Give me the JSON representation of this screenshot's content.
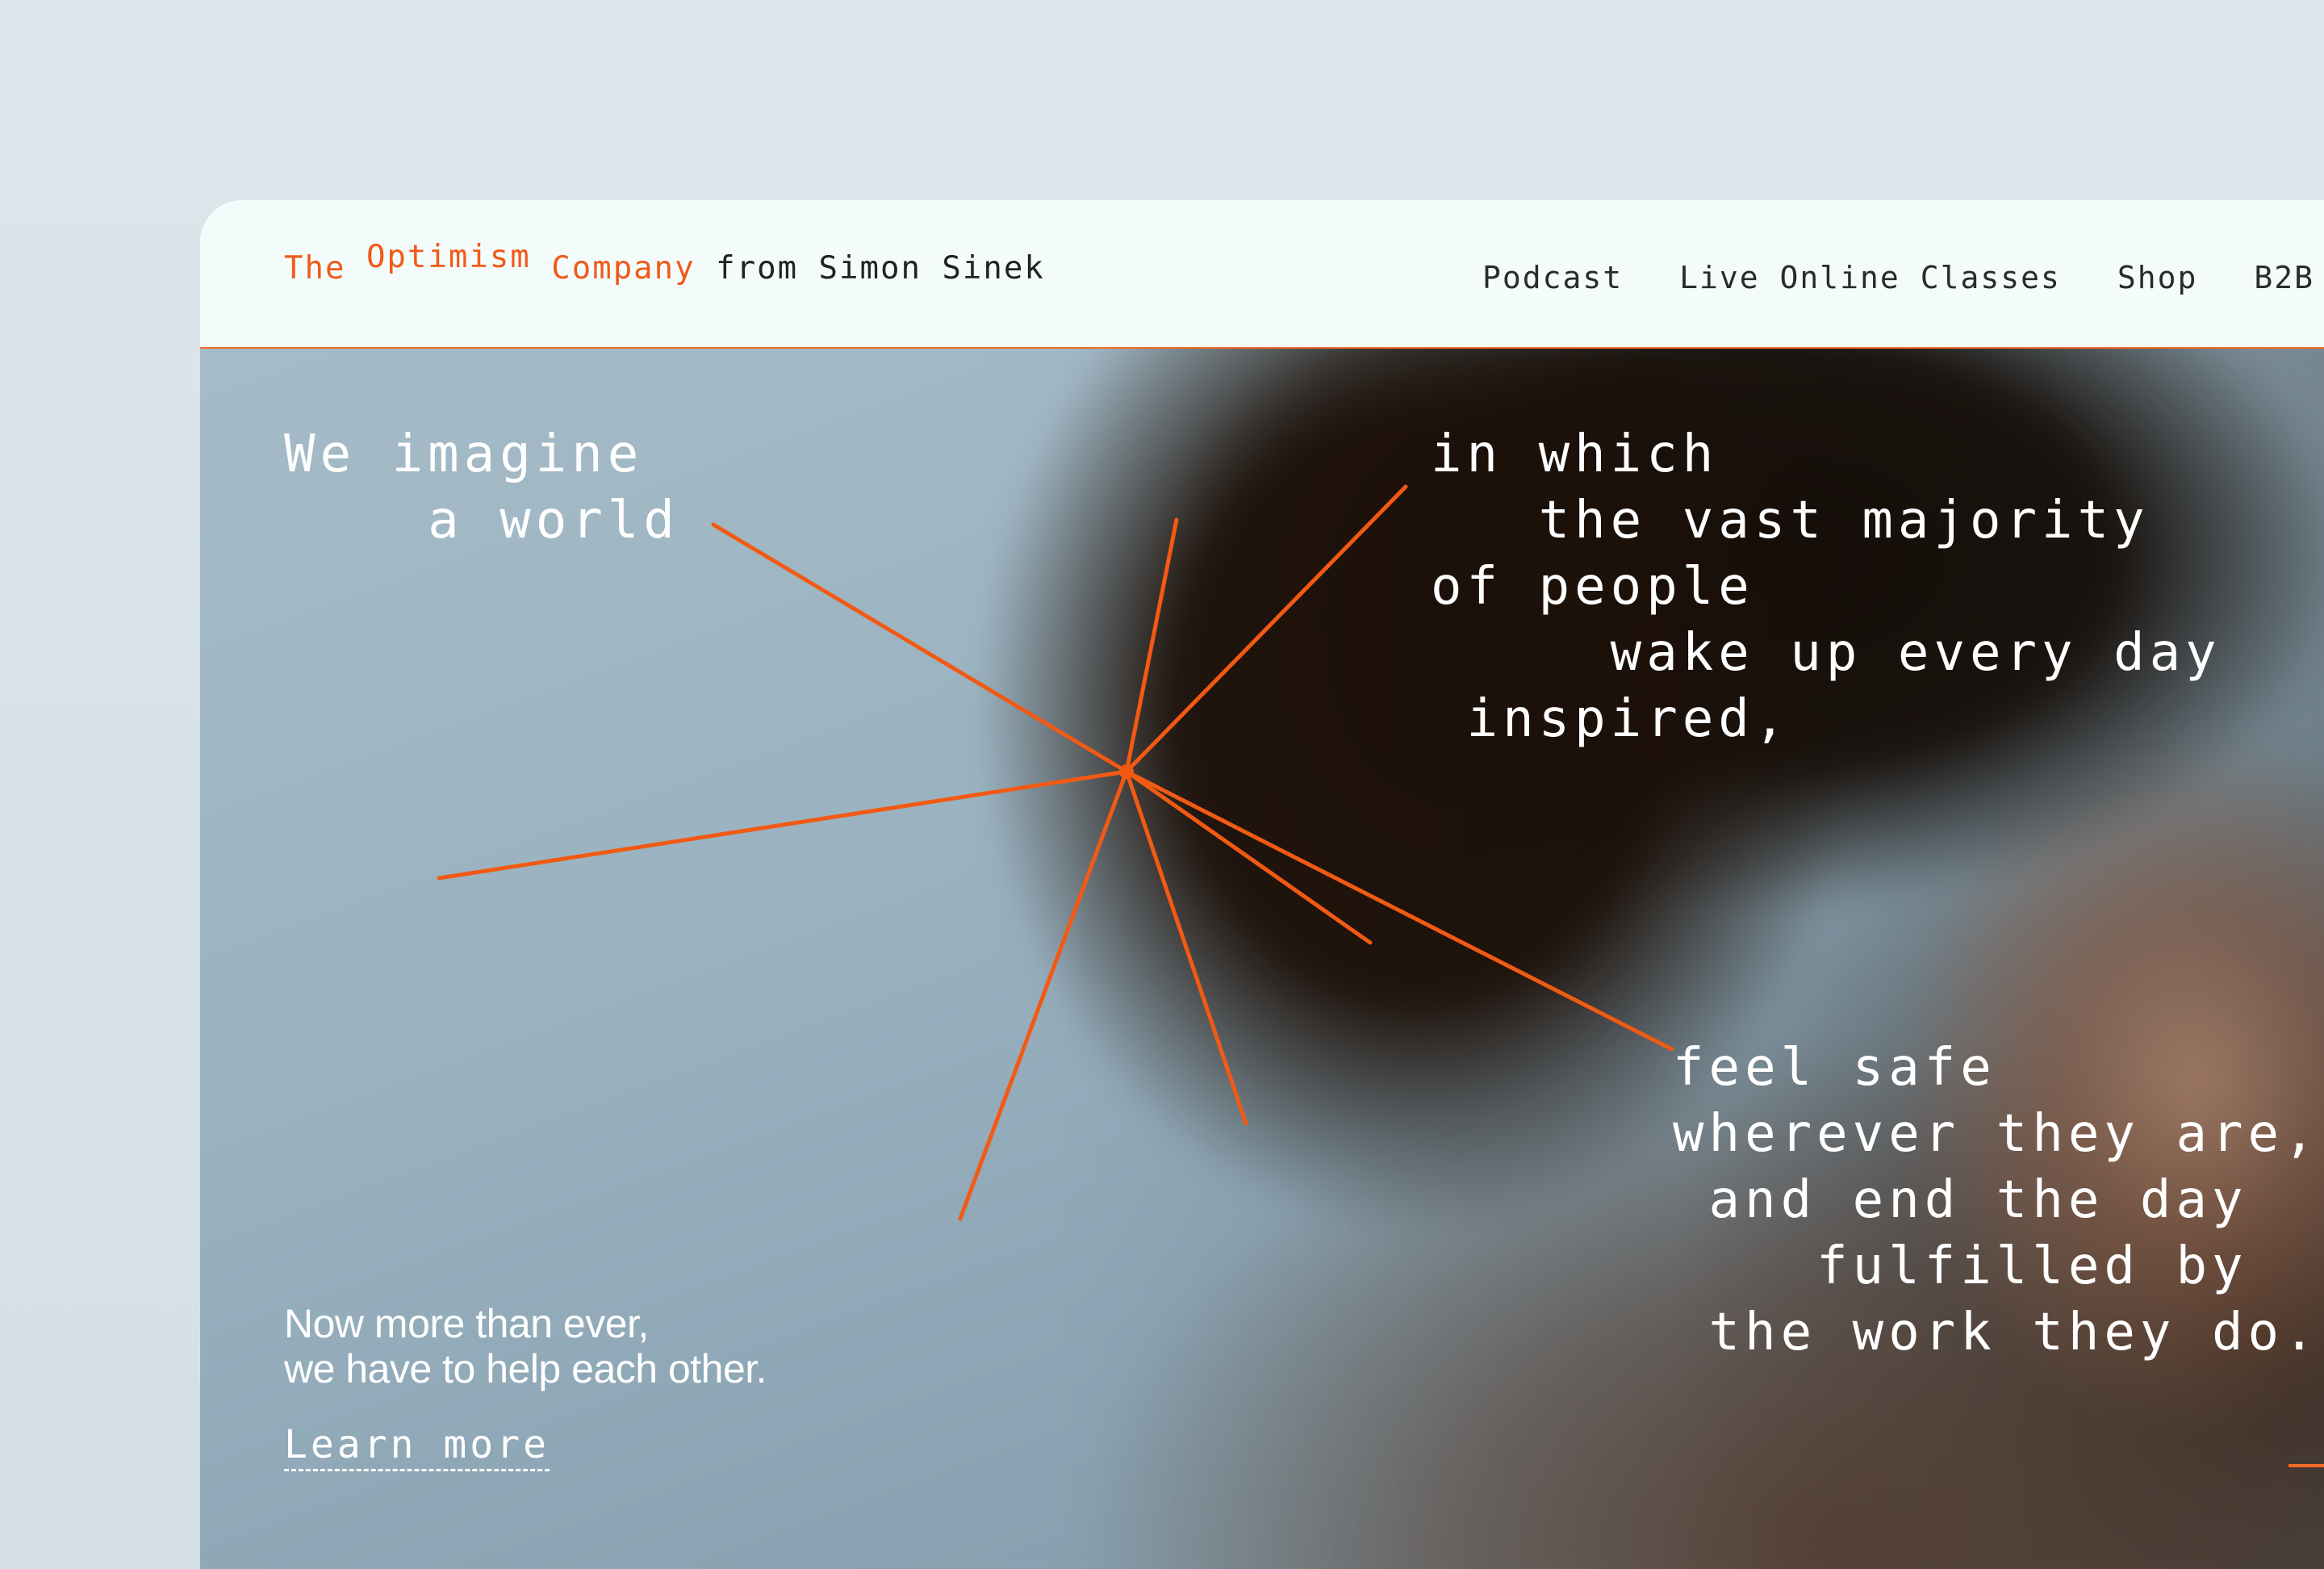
{
  "header": {
    "logo": {
      "the": "The",
      "optimism": "Optimism",
      "company": "Company",
      "from": "from Simon Sinek"
    },
    "nav": [
      "Podcast",
      "Live Online Classes",
      "Shop",
      "B2B"
    ]
  },
  "hero": {
    "verse_left": "We imagine\n    a world",
    "verse_top_right": "in which\n   the vast majority\nof people\n     wake up every day\n inspired,",
    "verse_bottom_right": "feel safe\nwherever they are,\n and end the day\n    fulfilled by\n the work they do.",
    "tagline_line1": "Now more than ever,",
    "tagline_line2": "we have to help each other.",
    "cta": "Learn more"
  },
  "colors": {
    "accent": "#f05a1a",
    "header_bg": "#f3fcfa",
    "text_dark": "#222222",
    "text_light": "#ffffff"
  }
}
